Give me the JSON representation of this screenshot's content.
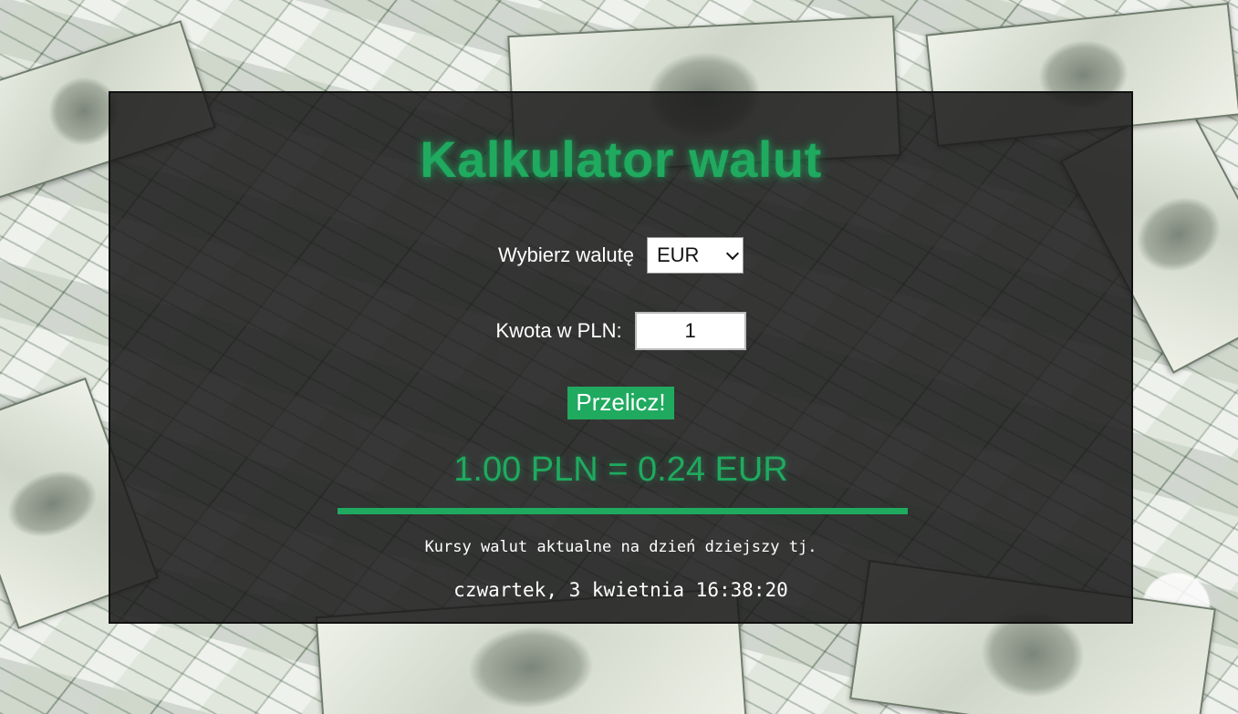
{
  "app": {
    "title": "Kalkulator walut"
  },
  "form": {
    "currency_label": "Wybierz walutę",
    "currency_selected": "EUR",
    "amount_label": "Kwota w PLN:",
    "amount_value": "1",
    "submit_label": "Przelicz!"
  },
  "result": {
    "text": "1.00 PLN = 0.24 EUR"
  },
  "footer": {
    "info_text": "Kursy walut aktualne na dzień dziejszy tj.",
    "datetime": "czwartek, 3 kwietnia 16:38:20"
  },
  "colors": {
    "accent": "#1faa5f",
    "panel_bg": "#191919"
  }
}
